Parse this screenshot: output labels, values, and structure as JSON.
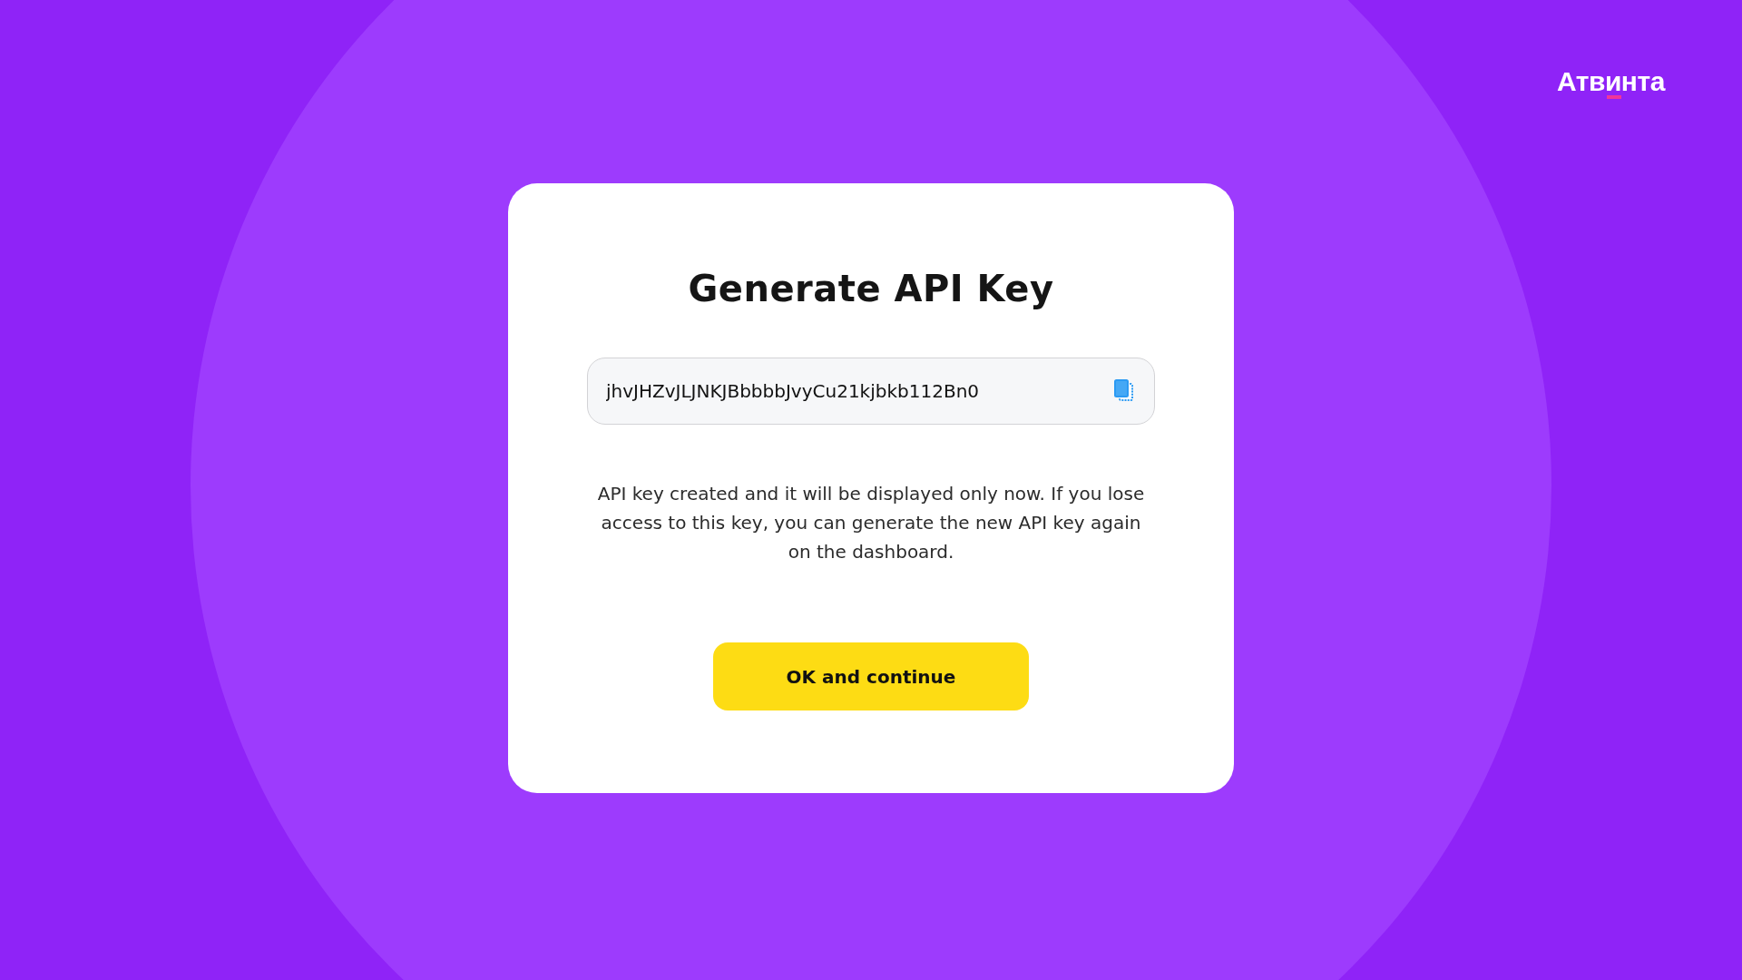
{
  "logo": {
    "text": "Атвинта"
  },
  "dialog": {
    "title": "Generate API Key",
    "api_key_field": {
      "value": "jhvJHZvJLJNKJBbbbbJvyCu21kjbkb112Bn0"
    },
    "message": "API key created and it will be displayed only now. If you lose access to this key, you can generate the new API key again on the dashboard.",
    "buttons": [
      "OK and continue"
    ]
  }
}
